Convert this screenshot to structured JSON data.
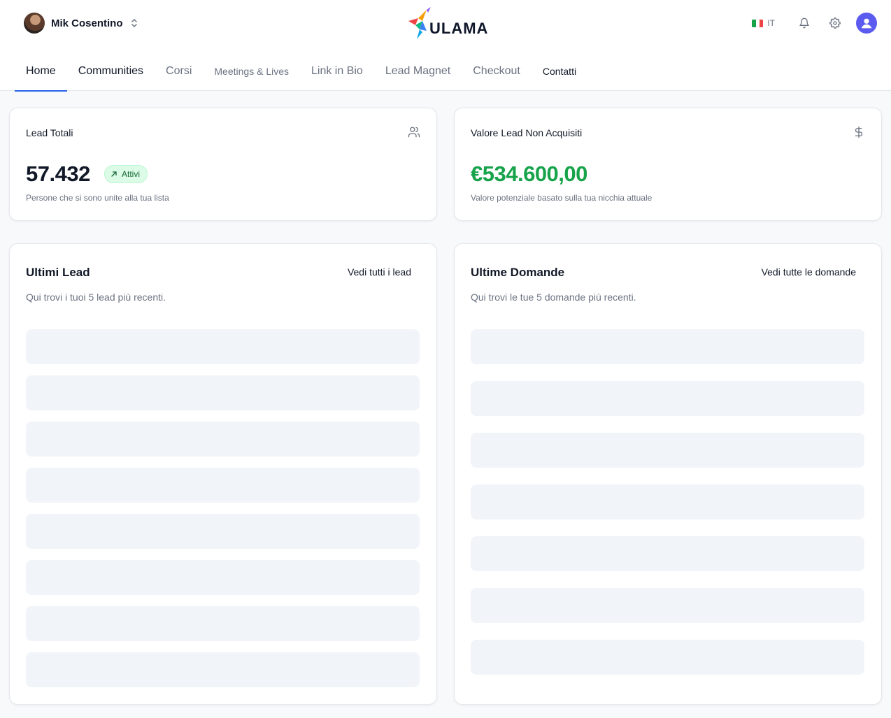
{
  "header": {
    "user_name": "Mik Cosentino",
    "logo_text": "ULAMA",
    "language": "IT",
    "colors": {
      "accent": "#2563eb",
      "avatar": "#5b5bf0"
    }
  },
  "nav": {
    "tabs": [
      {
        "label": "Home"
      },
      {
        "label": "Communities"
      },
      {
        "label": "Corsi"
      },
      {
        "label": "Meetings & Lives"
      },
      {
        "label": "Link in Bio"
      },
      {
        "label": "Lead Magnet"
      },
      {
        "label": "Checkout"
      },
      {
        "label": "Contatti"
      }
    ]
  },
  "stats": {
    "leads": {
      "title": "Lead Totali",
      "value": "57.432",
      "badge": "Attivi",
      "subtitle": "Persone che si sono unite alla tua lista",
      "icon": "users-icon"
    },
    "value": {
      "title": "Valore Lead Non Acquisiti",
      "value": "€534.600,00",
      "subtitle": "Valore potenziale basato sulla tua nicchia attuale",
      "icon": "dollar-icon",
      "color": "#16a34a"
    }
  },
  "latest_leads": {
    "title": "Ultimi Lead",
    "link": "Vedi tutti i lead",
    "subtitle": "Qui trovi i tuoi 5 lead più recenti."
  },
  "latest_questions": {
    "title": "Ultime Domande",
    "link": "Vedi tutte le domande",
    "subtitle": "Qui trovi le tue 5 domande più recenti."
  }
}
